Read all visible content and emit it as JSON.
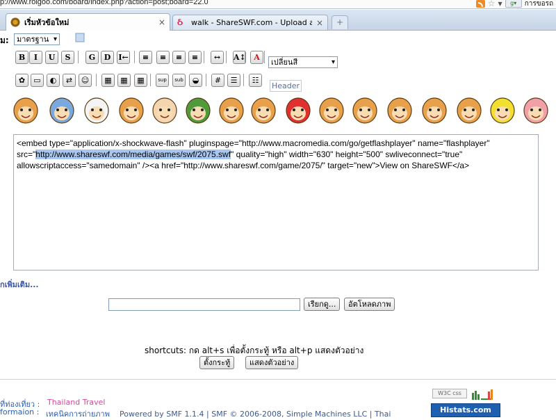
{
  "browser": {
    "url": "p://www.roigoo.com/board/index.php?action=post;board=22.0",
    "right_text": "การขอรถ",
    "tabs": [
      {
        "title": "เริ่มหัวข้อใหม่",
        "active": true
      },
      {
        "title": "walk - ShareSWF.com - Upload and ...",
        "active": false
      }
    ],
    "newtab_label": "+"
  },
  "editor": {
    "style_prefix": "ม:",
    "style_select": "มาตรฐาน",
    "color_select": "เปลี่ยนสี",
    "header_label": "Header",
    "toolbar_row1": [
      "B",
      "I",
      "U",
      "S",
      "G",
      "D",
      "I←",
      "≡",
      "≡",
      "≡",
      "≡",
      "↔",
      "A↕",
      "A"
    ],
    "toolbar_row2": [
      "✿",
      "▭",
      "◐",
      "⇄",
      "☺",
      "▦",
      "▦",
      "▦",
      "sup",
      "sub",
      "◒",
      "#",
      "☰",
      "☷"
    ],
    "smileys": [
      "monkey-laugh",
      "monkey-scooter",
      "tissue-face",
      "monkey-stand",
      "boy-cry",
      "green-bird",
      "monkey-fire",
      "monkey-sit",
      "red-angry",
      "monkey-cheer",
      "monkey-lying",
      "monkey-shout",
      "monkey-jump",
      "monkey-scream",
      "yellow-duck",
      "pink-pig"
    ],
    "content_before": "<embed type=\"application/x-shockwave-flash\" pluginspage=\"http://www.macromedia.com/go/getflashplayer\" name=\"flashplayer\" src=\"",
    "content_highlight": "http://www.shareswf.com/media/games/swf/2075.swf",
    "content_after": "\" quality=\"high\" width=\"630\" height=\"500\" swliveconnect=\"true\" allowscriptaccess=\"samedomain\" /><a href=\"http://www.shareswf.com/game/2075/\" target=\"new\">View on ShareSWF</a>"
  },
  "more_link": "กเพิ่มเติม...",
  "upload": {
    "browse_label": "เรียกดู...",
    "upload_label": "อัตโหลดภาพ"
  },
  "shortcuts_text": "shortcuts: กด alt+s เพื่อตั้งกระทู้ หรือ alt+p แสดงตัวอย่าง",
  "actions": {
    "post_label": "ตั้งกระทู้",
    "preview_label": "แสดงตัวอย่าง"
  },
  "footer": {
    "line1_prefix": "ที่ท่องเที่ยว : ",
    "line1_link": "Thailand Travel",
    "line2_prefix": "formaion : ",
    "line2_rest": "เทคนิคการถ่ายภาพ",
    "powered": "Powered by SMF 1.1.4 | SMF © 2006-2008, Simple Machines LLC | Thai",
    "w3c": "W3C css",
    "histats": "Histats.com"
  }
}
